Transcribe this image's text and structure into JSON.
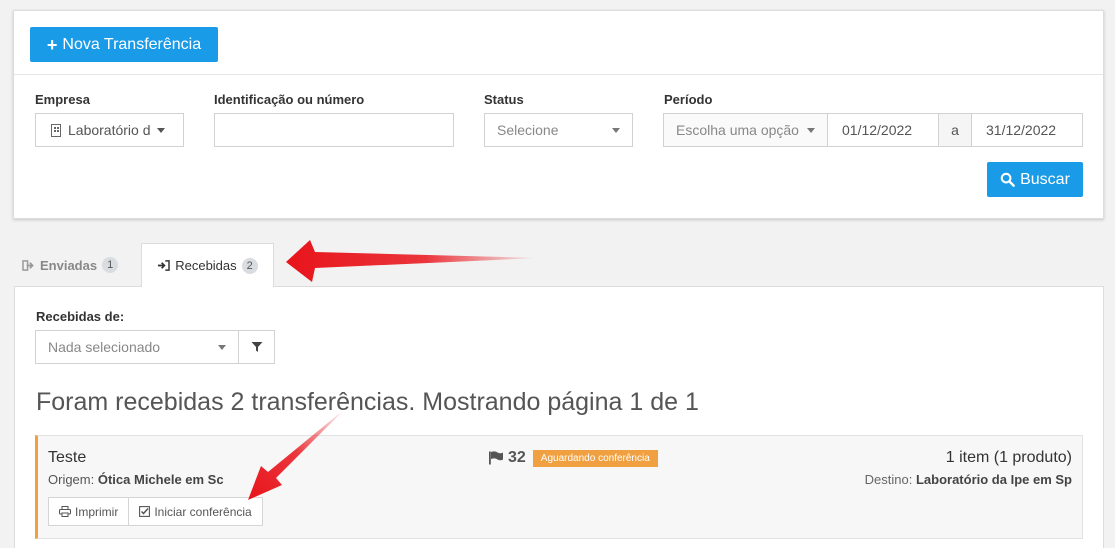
{
  "toolbar": {
    "new_label": "Nova Transferência",
    "search_label": "Buscar"
  },
  "filters": {
    "empresa": {
      "label": "Empresa",
      "value": "Laboratório d"
    },
    "identificacao": {
      "label": "Identificação ou número",
      "value": ""
    },
    "status": {
      "label": "Status",
      "placeholder": "Selecione"
    },
    "periodo": {
      "label": "Período",
      "option_placeholder": "Escolha uma opção",
      "start": "01/12/2022",
      "separator": "a",
      "end": "31/12/2022"
    }
  },
  "tabs": [
    {
      "label": "Enviadas",
      "count": "1",
      "active": false
    },
    {
      "label": "Recebidas",
      "count": "2",
      "active": true
    }
  ],
  "received": {
    "from_label": "Recebidas de:",
    "from_placeholder": "Nada selecionado",
    "summary": "Foram recebidas 2 transferências. Mostrando página 1 de 1"
  },
  "transfers": [
    {
      "title": "Teste",
      "origin_label": "Origem:",
      "origin": "Ótica Michele em Sc",
      "number": "32",
      "status": "Aguardando conferência",
      "items": "1 item (1 produto)",
      "destination_label": "Destino:",
      "destination": "Laboratório da Ipe em Sp",
      "actions": {
        "print_label": "Imprimir",
        "check_label": "Iniciar conferência"
      }
    }
  ],
  "colors": {
    "primary": "#1a9be8",
    "warning": "#f0a040",
    "arrow": "#e8141b"
  },
  "icons": [
    "plus-icon",
    "building-icon",
    "chevron-down-icon",
    "calendar-separator",
    "search-icon",
    "sign-out-icon",
    "sign-in-icon",
    "filter-icon",
    "flag-icon",
    "print-icon",
    "check-square-icon"
  ]
}
